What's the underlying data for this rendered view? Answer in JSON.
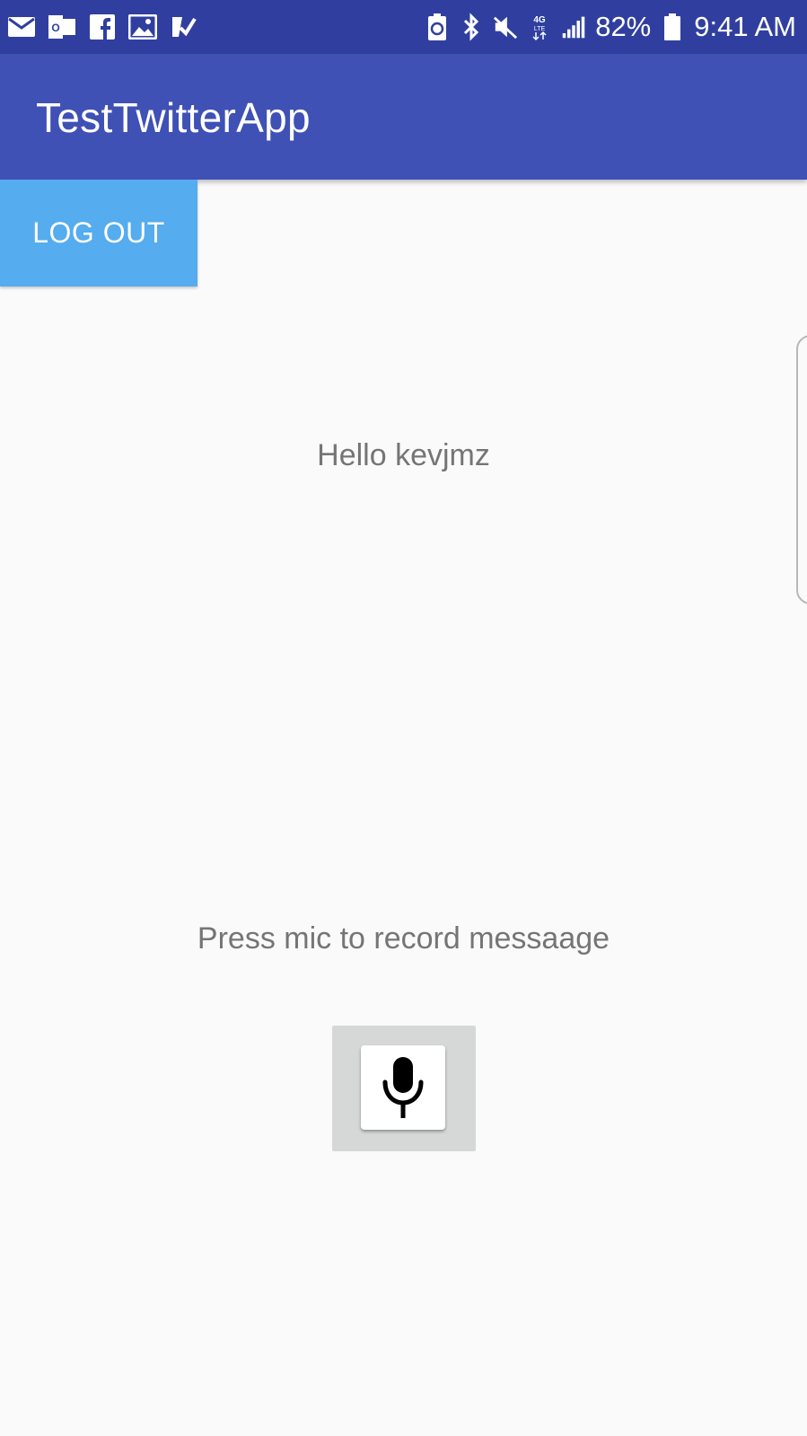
{
  "status_bar": {
    "left_icons": [
      "mail-icon",
      "outlook-icon",
      "facebook-icon",
      "gallery-icon",
      "tasks-icon"
    ],
    "right_icons": [
      "battery-saver-icon",
      "bluetooth-icon",
      "mute-icon",
      "lte-icon",
      "signal-icon",
      "battery-icon"
    ],
    "battery_percent": "82%",
    "time": "9:41 AM",
    "background_color": "#303f9f"
  },
  "app_bar": {
    "title": "TestTwitterApp",
    "background_color": "#3f51b5"
  },
  "logout_button": {
    "label": "LOG OUT",
    "color": "#55acee"
  },
  "main": {
    "greeting": "Hello kevjmz",
    "instruction": "Press mic to record messaage"
  },
  "mic": {
    "icon": "microphone-icon"
  }
}
